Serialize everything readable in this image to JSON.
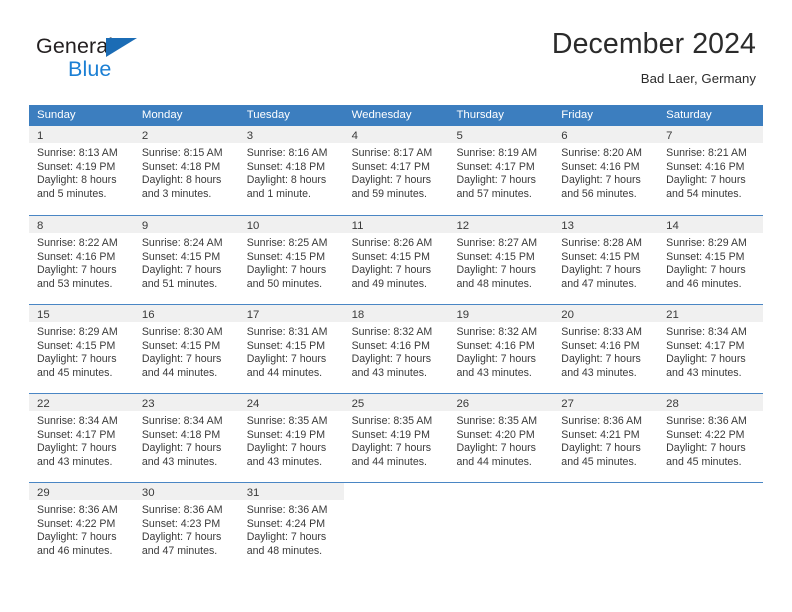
{
  "brand": {
    "line1": "General",
    "line2": "Blue",
    "triangle_color": "#1b6cb5",
    "text_color_line1": "#231f20",
    "text_color_line2": "#1b7fd4"
  },
  "header": {
    "title": "December 2024",
    "location": "Bad Laer, Germany"
  },
  "theme": {
    "header_bar_color": "#3c7ebf",
    "header_bar_text": "#ffffff",
    "day_band_color": "#f0f0f0",
    "row_divider_color": "#4a86c4",
    "body_text_color": "#3a3a3a"
  },
  "weekdays": [
    "Sunday",
    "Monday",
    "Tuesday",
    "Wednesday",
    "Thursday",
    "Friday",
    "Saturday"
  ],
  "weeks": [
    [
      {
        "day": "1",
        "sunrise": "Sunrise: 8:13 AM",
        "sunset": "Sunset: 4:19 PM",
        "daylight1": "Daylight: 8 hours",
        "daylight2": "and 5 minutes."
      },
      {
        "day": "2",
        "sunrise": "Sunrise: 8:15 AM",
        "sunset": "Sunset: 4:18 PM",
        "daylight1": "Daylight: 8 hours",
        "daylight2": "and 3 minutes."
      },
      {
        "day": "3",
        "sunrise": "Sunrise: 8:16 AM",
        "sunset": "Sunset: 4:18 PM",
        "daylight1": "Daylight: 8 hours",
        "daylight2": "and 1 minute."
      },
      {
        "day": "4",
        "sunrise": "Sunrise: 8:17 AM",
        "sunset": "Sunset: 4:17 PM",
        "daylight1": "Daylight: 7 hours",
        "daylight2": "and 59 minutes."
      },
      {
        "day": "5",
        "sunrise": "Sunrise: 8:19 AM",
        "sunset": "Sunset: 4:17 PM",
        "daylight1": "Daylight: 7 hours",
        "daylight2": "and 57 minutes."
      },
      {
        "day": "6",
        "sunrise": "Sunrise: 8:20 AM",
        "sunset": "Sunset: 4:16 PM",
        "daylight1": "Daylight: 7 hours",
        "daylight2": "and 56 minutes."
      },
      {
        "day": "7",
        "sunrise": "Sunrise: 8:21 AM",
        "sunset": "Sunset: 4:16 PM",
        "daylight1": "Daylight: 7 hours",
        "daylight2": "and 54 minutes."
      }
    ],
    [
      {
        "day": "8",
        "sunrise": "Sunrise: 8:22 AM",
        "sunset": "Sunset: 4:16 PM",
        "daylight1": "Daylight: 7 hours",
        "daylight2": "and 53 minutes."
      },
      {
        "day": "9",
        "sunrise": "Sunrise: 8:24 AM",
        "sunset": "Sunset: 4:15 PM",
        "daylight1": "Daylight: 7 hours",
        "daylight2": "and 51 minutes."
      },
      {
        "day": "10",
        "sunrise": "Sunrise: 8:25 AM",
        "sunset": "Sunset: 4:15 PM",
        "daylight1": "Daylight: 7 hours",
        "daylight2": "and 50 minutes."
      },
      {
        "day": "11",
        "sunrise": "Sunrise: 8:26 AM",
        "sunset": "Sunset: 4:15 PM",
        "daylight1": "Daylight: 7 hours",
        "daylight2": "and 49 minutes."
      },
      {
        "day": "12",
        "sunrise": "Sunrise: 8:27 AM",
        "sunset": "Sunset: 4:15 PM",
        "daylight1": "Daylight: 7 hours",
        "daylight2": "and 48 minutes."
      },
      {
        "day": "13",
        "sunrise": "Sunrise: 8:28 AM",
        "sunset": "Sunset: 4:15 PM",
        "daylight1": "Daylight: 7 hours",
        "daylight2": "and 47 minutes."
      },
      {
        "day": "14",
        "sunrise": "Sunrise: 8:29 AM",
        "sunset": "Sunset: 4:15 PM",
        "daylight1": "Daylight: 7 hours",
        "daylight2": "and 46 minutes."
      }
    ],
    [
      {
        "day": "15",
        "sunrise": "Sunrise: 8:29 AM",
        "sunset": "Sunset: 4:15 PM",
        "daylight1": "Daylight: 7 hours",
        "daylight2": "and 45 minutes."
      },
      {
        "day": "16",
        "sunrise": "Sunrise: 8:30 AM",
        "sunset": "Sunset: 4:15 PM",
        "daylight1": "Daylight: 7 hours",
        "daylight2": "and 44 minutes."
      },
      {
        "day": "17",
        "sunrise": "Sunrise: 8:31 AM",
        "sunset": "Sunset: 4:15 PM",
        "daylight1": "Daylight: 7 hours",
        "daylight2": "and 44 minutes."
      },
      {
        "day": "18",
        "sunrise": "Sunrise: 8:32 AM",
        "sunset": "Sunset: 4:16 PM",
        "daylight1": "Daylight: 7 hours",
        "daylight2": "and 43 minutes."
      },
      {
        "day": "19",
        "sunrise": "Sunrise: 8:32 AM",
        "sunset": "Sunset: 4:16 PM",
        "daylight1": "Daylight: 7 hours",
        "daylight2": "and 43 minutes."
      },
      {
        "day": "20",
        "sunrise": "Sunrise: 8:33 AM",
        "sunset": "Sunset: 4:16 PM",
        "daylight1": "Daylight: 7 hours",
        "daylight2": "and 43 minutes."
      },
      {
        "day": "21",
        "sunrise": "Sunrise: 8:34 AM",
        "sunset": "Sunset: 4:17 PM",
        "daylight1": "Daylight: 7 hours",
        "daylight2": "and 43 minutes."
      }
    ],
    [
      {
        "day": "22",
        "sunrise": "Sunrise: 8:34 AM",
        "sunset": "Sunset: 4:17 PM",
        "daylight1": "Daylight: 7 hours",
        "daylight2": "and 43 minutes."
      },
      {
        "day": "23",
        "sunrise": "Sunrise: 8:34 AM",
        "sunset": "Sunset: 4:18 PM",
        "daylight1": "Daylight: 7 hours",
        "daylight2": "and 43 minutes."
      },
      {
        "day": "24",
        "sunrise": "Sunrise: 8:35 AM",
        "sunset": "Sunset: 4:19 PM",
        "daylight1": "Daylight: 7 hours",
        "daylight2": "and 43 minutes."
      },
      {
        "day": "25",
        "sunrise": "Sunrise: 8:35 AM",
        "sunset": "Sunset: 4:19 PM",
        "daylight1": "Daylight: 7 hours",
        "daylight2": "and 44 minutes."
      },
      {
        "day": "26",
        "sunrise": "Sunrise: 8:35 AM",
        "sunset": "Sunset: 4:20 PM",
        "daylight1": "Daylight: 7 hours",
        "daylight2": "and 44 minutes."
      },
      {
        "day": "27",
        "sunrise": "Sunrise: 8:36 AM",
        "sunset": "Sunset: 4:21 PM",
        "daylight1": "Daylight: 7 hours",
        "daylight2": "and 45 minutes."
      },
      {
        "day": "28",
        "sunrise": "Sunrise: 8:36 AM",
        "sunset": "Sunset: 4:22 PM",
        "daylight1": "Daylight: 7 hours",
        "daylight2": "and 45 minutes."
      }
    ],
    [
      {
        "day": "29",
        "sunrise": "Sunrise: 8:36 AM",
        "sunset": "Sunset: 4:22 PM",
        "daylight1": "Daylight: 7 hours",
        "daylight2": "and 46 minutes."
      },
      {
        "day": "30",
        "sunrise": "Sunrise: 8:36 AM",
        "sunset": "Sunset: 4:23 PM",
        "daylight1": "Daylight: 7 hours",
        "daylight2": "and 47 minutes."
      },
      {
        "day": "31",
        "sunrise": "Sunrise: 8:36 AM",
        "sunset": "Sunset: 4:24 PM",
        "daylight1": "Daylight: 7 hours",
        "daylight2": "and 48 minutes."
      },
      {
        "day": "",
        "sunrise": "",
        "sunset": "",
        "daylight1": "",
        "daylight2": ""
      },
      {
        "day": "",
        "sunrise": "",
        "sunset": "",
        "daylight1": "",
        "daylight2": ""
      },
      {
        "day": "",
        "sunrise": "",
        "sunset": "",
        "daylight1": "",
        "daylight2": ""
      },
      {
        "day": "",
        "sunrise": "",
        "sunset": "",
        "daylight1": "",
        "daylight2": ""
      }
    ]
  ]
}
